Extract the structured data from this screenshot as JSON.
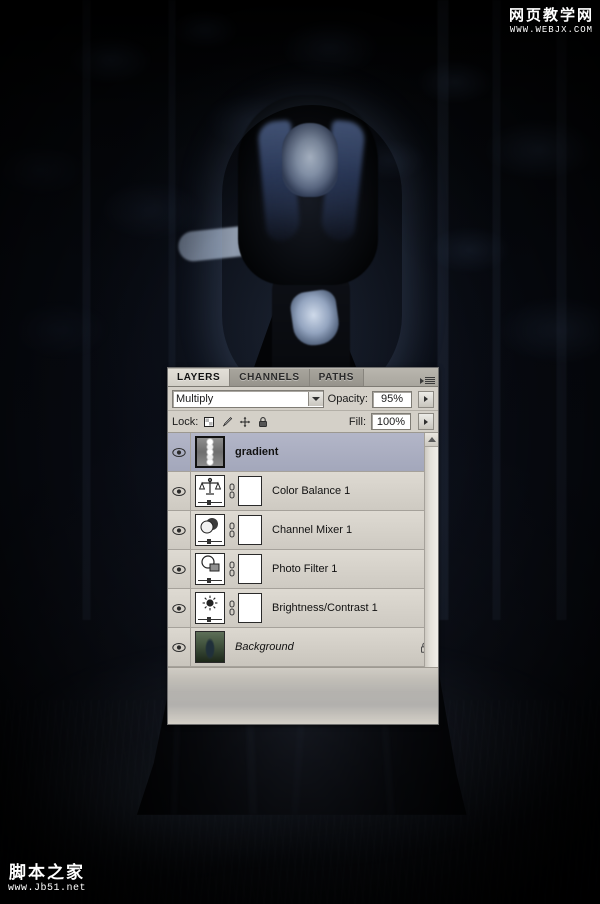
{
  "watermarks": {
    "top_right": {
      "cn": "网页教学网",
      "url": "WWW.WEBJX.COM"
    },
    "bottom_left": {
      "cn": "脚本之家",
      "url": "www.Jb51.net"
    }
  },
  "panel": {
    "tabs": [
      {
        "label": "LAYERS",
        "active": true
      },
      {
        "label": "CHANNELS",
        "active": false
      },
      {
        "label": "PATHS",
        "active": false
      }
    ],
    "flyout_icon": "panel-menu-icon",
    "blend_mode": "Multiply",
    "opacity_label": "Opacity:",
    "opacity_value": "95%",
    "lock_label": "Lock:",
    "lock_icons": [
      "lock-transparent-pixels-icon",
      "lock-image-pixels-icon",
      "lock-position-icon",
      "lock-all-icon"
    ],
    "fill_label": "Fill:",
    "fill_value": "100%",
    "layers": [
      {
        "name": "gradient",
        "visible": true,
        "selected": true,
        "thumb_kind": "gradient",
        "has_mask": false,
        "locked": false,
        "italic": false
      },
      {
        "name": "Color Balance 1",
        "visible": true,
        "selected": false,
        "thumb_kind": "adjustment-color-balance",
        "has_mask": true,
        "locked": false,
        "italic": false
      },
      {
        "name": "Channel Mixer 1",
        "visible": true,
        "selected": false,
        "thumb_kind": "adjustment-channel-mixer",
        "has_mask": true,
        "locked": false,
        "italic": false
      },
      {
        "name": "Photo Filter 1",
        "visible": true,
        "selected": false,
        "thumb_kind": "adjustment-photo-filter",
        "has_mask": true,
        "locked": false,
        "italic": false
      },
      {
        "name": "Brightness/Contrast 1",
        "visible": true,
        "selected": false,
        "thumb_kind": "adjustment-brightness-contrast",
        "has_mask": true,
        "locked": false,
        "italic": false
      },
      {
        "name": "Background",
        "visible": true,
        "selected": false,
        "thumb_kind": "photo",
        "has_mask": false,
        "locked": true,
        "italic": true
      }
    ]
  },
  "colors": {
    "panel_face": "#d4d0c8",
    "panel_selected_row": "#a8acc0",
    "tab_active": "#e2dfd7",
    "text": "#1b1b1b",
    "artwork_dark": "#050608",
    "artwork_blue": "#46587a"
  }
}
